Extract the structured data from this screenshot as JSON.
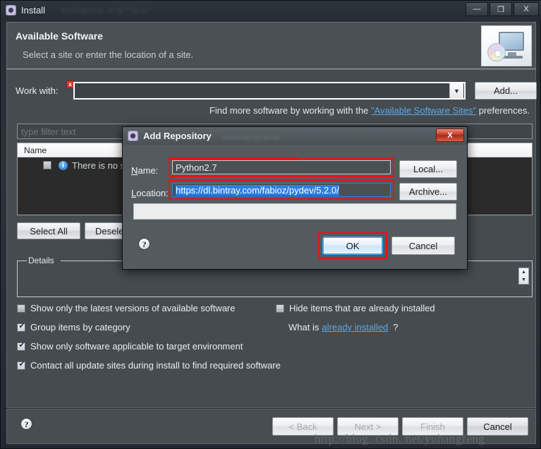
{
  "window": {
    "title": "Install",
    "icon": "gear-icon",
    "blurred_background_text": "software a*a**@a*",
    "controls": {
      "minimize": "—",
      "maximize": "❐",
      "close": "X"
    }
  },
  "header": {
    "title": "Available Software",
    "subtitle": "Select a site or enter the location of a site.",
    "banner_icon": "monitor-cd-icon"
  },
  "work_with": {
    "label": "Work with:",
    "error_badge": "x",
    "value": "",
    "placeholder": "",
    "dropdown_arrow": "▼",
    "add_button": "Add..."
  },
  "find_more": {
    "prefix": "Find more software by working with the ",
    "link": "\"Available Software Sites\"",
    "suffix": " preferences."
  },
  "filter": {
    "placeholder": "type filter text",
    "value": ""
  },
  "table": {
    "columns": [
      "Name",
      ""
    ],
    "rows": [
      {
        "checked": false,
        "icon": "info-icon",
        "label": "There is no site"
      }
    ]
  },
  "selection_buttons": {
    "select_all": "Select All",
    "deselect_all": "Deselect All"
  },
  "details": {
    "legend": "Details",
    "content": "",
    "spinner_up": "▲",
    "spinner_down": "▼"
  },
  "options": {
    "left": [
      {
        "label": "Show only the latest versions of available software",
        "checked": false
      },
      {
        "label": "Group items by category",
        "checked": true
      },
      {
        "label": "Show only software applicable to target environment",
        "checked": true
      },
      {
        "label": "Contact all update sites during install to find required software",
        "checked": true
      }
    ],
    "right": {
      "checkbox": {
        "label": "Hide items that are already installed",
        "checked": false
      },
      "what_is_prefix": "What is ",
      "what_is_link": "already installed",
      "what_is_suffix": "?"
    }
  },
  "footer": {
    "help_icon": "?",
    "buttons": [
      {
        "label": "< Back",
        "enabled": false
      },
      {
        "label": "Next >",
        "enabled": false
      },
      {
        "label": "Finish",
        "enabled": false
      },
      {
        "label": "Cancel",
        "enabled": true
      }
    ]
  },
  "watermark": "http://blog. csdn. net/yuhangfeng",
  "dialog": {
    "title": "Add Repository",
    "icon": "gear-icon",
    "close": "X",
    "name_label_pre": "N",
    "name_label_post": "ame:",
    "name_value": "Python2.7",
    "location_label_pre": "L",
    "location_label_post": "ocation:",
    "location_value": "https://dl.bintray.com/fabioz/pydev/5.2.0/",
    "local_button": "Local...",
    "archive_button": "Archive...",
    "ok_button": "OK",
    "cancel_button": "Cancel",
    "help_icon": "?"
  },
  "colors": {
    "window_bg": "#2b3238",
    "body_bg": "#454b4f",
    "dialog_bg": "#545a5e",
    "link": "#5aa8e8",
    "annotation_red": "#e81313",
    "selection_blue": "#2f7fe0",
    "focus_blue": "#3aa8e8",
    "error_red": "#d03a2c"
  }
}
